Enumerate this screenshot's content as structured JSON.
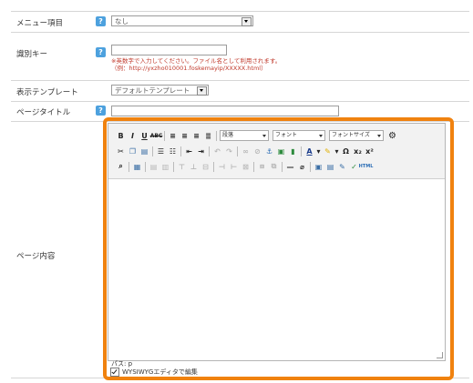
{
  "fields": {
    "menu_item": {
      "label": "メニュー項目",
      "value": "なし"
    },
    "identifier_key": {
      "label": "識別キー",
      "value": "",
      "note_line1": "※英数字で入力してください。ファイル名として利用されます。",
      "note_line2": "（例：http://yxzho010001.foskemayip/XXXXX.html）"
    },
    "display_template": {
      "label": "表示テンプレート",
      "value": "デフォルトテンプレート"
    },
    "page_title": {
      "label": "ページタイトル",
      "value": ""
    },
    "page_content": {
      "label": "ページ内容"
    }
  },
  "editor": {
    "toolbar": {
      "format_select": "段落",
      "font_select": "フォント",
      "font_size_select": "フォントサイズ"
    },
    "path_label": "パス: p",
    "wysiwyg_label": "WYSIWYGエディタで編集"
  },
  "colors": {
    "highlight": "#f0820f",
    "help_icon": "#4da1de",
    "note": "#c0392b"
  }
}
